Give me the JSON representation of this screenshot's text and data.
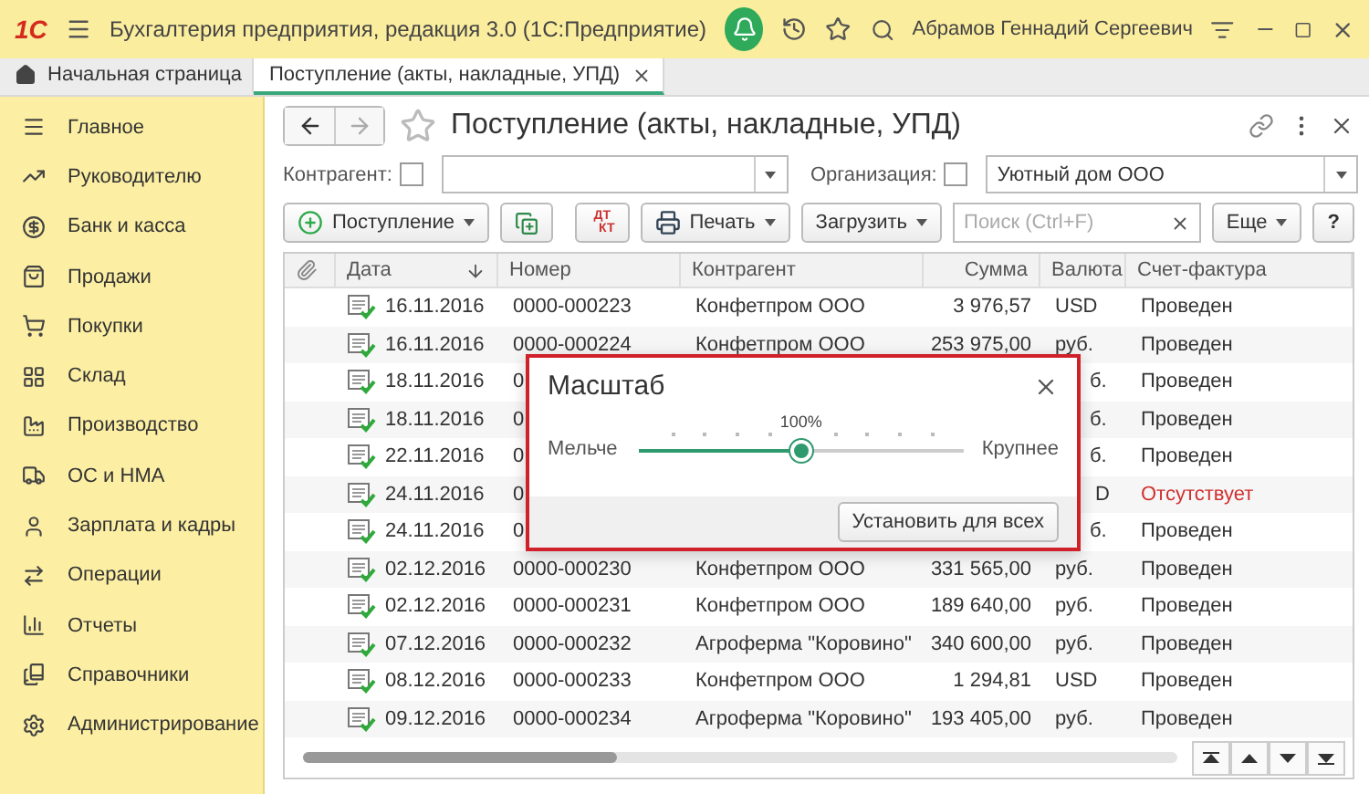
{
  "window": {
    "logo": "1С",
    "title": "Бухгалтерия предприятия, редакция 3.0  (1С:Предприятие)",
    "user": "Абрамов Геннадий Сергеевич"
  },
  "tabs": [
    {
      "label": "Начальная страница",
      "selected": false
    },
    {
      "label": "Поступление (акты, накладные, УПД)",
      "selected": true
    }
  ],
  "sidebar": {
    "items": [
      "Главное",
      "Руководителю",
      "Банк и касса",
      "Продажи",
      "Покупки",
      "Склад",
      "Производство",
      "ОС и НМА",
      "Зарплата и кадры",
      "Операции",
      "Отчеты",
      "Справочники",
      "Администрирование"
    ]
  },
  "form": {
    "title": "Поступление (акты, накладные, УПД)",
    "filters": [
      {
        "label": "Контрагент:",
        "checked": false
      },
      {
        "label": "Организация:",
        "checked": false,
        "value": "Уютный дом ООО"
      }
    ],
    "toolbar": {
      "create": "Поступление",
      "dtkt": [
        "ДТ",
        "КТ"
      ],
      "print": "Печать",
      "load": "Загрузить",
      "search_placeholder": "Поиск (Ctrl+F)",
      "more": "Еще",
      "help": "?"
    }
  },
  "table": {
    "columns": [
      "Дата",
      "Номер",
      "Контрагент",
      "Сумма",
      "Валюта",
      "Счет-фактура"
    ],
    "rows": [
      {
        "date": "16.11.2016",
        "number": "0000-000223",
        "counterparty": "Конфетпром ООО",
        "sum": "3 976,57",
        "currency": "USD",
        "invoice": "Проведен",
        "color": "#333333",
        "covered": false
      },
      {
        "date": "16.11.2016",
        "number": "0000-000224",
        "counterparty": "Конфетпром ООО",
        "sum": "253 975,00",
        "currency": "руб.",
        "invoice": "Проведен",
        "color": "#333333",
        "covered": false
      },
      {
        "date": "18.11.2016",
        "number": "0",
        "currency": "б.",
        "invoice": "Проведен",
        "color": "#333333",
        "covered": true
      },
      {
        "date": "18.11.2016",
        "number": "0",
        "currency": "б.",
        "invoice": "Проведен",
        "color": "#333333",
        "covered": true
      },
      {
        "date": "22.11.2016",
        "number": "0",
        "currency": "б.",
        "invoice": "Проведен",
        "color": "#333333",
        "covered": true
      },
      {
        "date": "24.11.2016",
        "number": "0",
        "currency": "D",
        "invoice": "Отсутствует",
        "color": "#d03030",
        "covered": true
      },
      {
        "date": "24.11.2016",
        "number": "0",
        "currency": "б.",
        "invoice": "Проведен",
        "color": "#333333",
        "covered": true
      },
      {
        "date": "02.12.2016",
        "number": "0000-000230",
        "counterparty": "Конфетпром ООО",
        "sum": "331 565,00",
        "currency": "руб.",
        "invoice": "Проведен",
        "color": "#333333",
        "covered": false
      },
      {
        "date": "02.12.2016",
        "number": "0000-000231",
        "counterparty": "Конфетпром ООО",
        "sum": "189 640,00",
        "currency": "руб.",
        "invoice": "Проведен",
        "color": "#333333",
        "covered": false
      },
      {
        "date": "07.12.2016",
        "number": "0000-000232",
        "counterparty": "Агроферма \"Коровино\"",
        "sum": "340 600,00",
        "currency": "руб.",
        "invoice": "Проведен",
        "color": "#333333",
        "covered": false
      },
      {
        "date": "08.12.2016",
        "number": "0000-000233",
        "counterparty": "Конфетпром ООО",
        "sum": "1 294,81",
        "currency": "USD",
        "invoice": "Проведен",
        "color": "#333333",
        "covered": false
      },
      {
        "date": "09.12.2016",
        "number": "0000-000234",
        "counterparty": "Агроферма \"Коровино\"",
        "sum": "193 405,00",
        "currency": "руб.",
        "invoice": "Проведен",
        "color": "#333333",
        "covered": false
      }
    ]
  },
  "dialog": {
    "title": "Масштаб",
    "smaller": "Мельче",
    "larger": "Крупнее",
    "reading": "100%",
    "level": 0.5,
    "button": "Установить для всех"
  }
}
